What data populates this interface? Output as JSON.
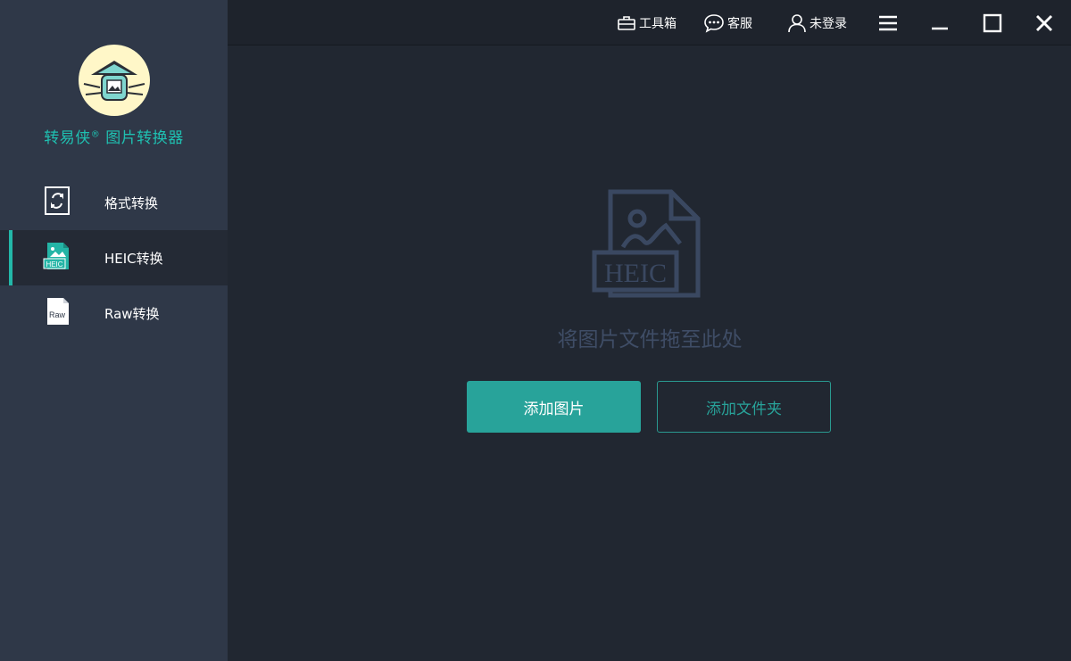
{
  "app": {
    "name": "转易侠",
    "name_mark": "®",
    "name_suffix": "图片转换器"
  },
  "sidebar": {
    "items": [
      {
        "label": "格式转换",
        "icon": "format-convert-icon",
        "active": false
      },
      {
        "label": "HEIC转换",
        "icon": "heic-file-icon",
        "icon_text": "HEIC",
        "active": true
      },
      {
        "label": "Raw转换",
        "icon": "raw-file-icon",
        "icon_text": "Raw",
        "active": false
      }
    ]
  },
  "topbar": {
    "toolbox_label": "工具箱",
    "service_label": "客服",
    "login_label": "未登录"
  },
  "main": {
    "drop_icon_text": "HEIC",
    "drop_hint": "将图片文件拖至此处",
    "add_image_label": "添加图片",
    "add_folder_label": "添加文件夹"
  },
  "colors": {
    "accent": "#28a39a",
    "sidebar_bg": "#2f3848",
    "main_bg": "#212731",
    "topbar_bg": "#1e232c",
    "hint_text": "#3f4d66"
  }
}
